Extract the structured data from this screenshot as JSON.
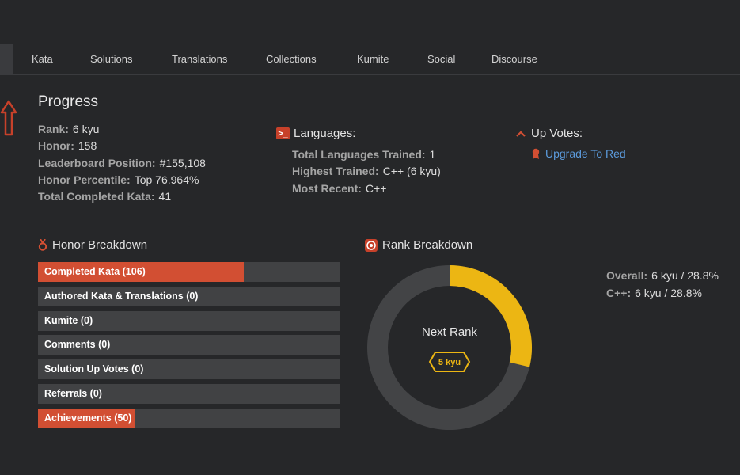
{
  "nav": {
    "items": [
      {
        "label": "Kata"
      },
      {
        "label": "Solutions"
      },
      {
        "label": "Translations"
      },
      {
        "label": "Collections"
      },
      {
        "label": "Kumite"
      },
      {
        "label": "Social"
      },
      {
        "label": "Discourse"
      }
    ]
  },
  "progress": {
    "title": "Progress",
    "stats": [
      {
        "label": "Rank:",
        "value": "6 kyu"
      },
      {
        "label": "Honor:",
        "value": "158"
      },
      {
        "label": "Leaderboard Position:",
        "value": "#155,108"
      },
      {
        "label": "Honor Percentile:",
        "value": "Top 76.964%"
      },
      {
        "label": "Total Completed Kata:",
        "value": "41"
      }
    ]
  },
  "languages": {
    "heading": "Languages:",
    "icon": "terminal-icon",
    "rows": [
      {
        "label": "Total Languages Trained:",
        "value": "1"
      },
      {
        "label": "Highest Trained:",
        "value": "C++ (6 kyu)"
      },
      {
        "label": "Most Recent:",
        "value": "C++"
      }
    ]
  },
  "upvotes": {
    "heading": "Up Votes:",
    "icon": "chevron-up-icon",
    "link_label": "Upgrade To Red",
    "link_icon": "ribbon-icon"
  },
  "honor_breakdown": {
    "heading": "Honor Breakdown",
    "icon": "medal-icon",
    "bars": [
      {
        "label": "Completed Kata (106)",
        "fill": 0.68
      },
      {
        "label": "Authored Kata & Translations (0)",
        "fill": 0
      },
      {
        "label": "Kumite (0)",
        "fill": 0
      },
      {
        "label": "Comments (0)",
        "fill": 0
      },
      {
        "label": "Solution Up Votes (0)",
        "fill": 0
      },
      {
        "label": "Referrals (0)",
        "fill": 0
      },
      {
        "label": "Achievements (50)",
        "fill": 0.32
      }
    ]
  },
  "rank_breakdown": {
    "heading": "Rank Breakdown",
    "icon": "target-icon",
    "donut_center_label": "Next Rank",
    "next_rank": "5 kyu",
    "progress": 0.288,
    "rows": [
      {
        "label": "Overall:",
        "value": "6 kyu / 28.8%"
      },
      {
        "label": "C++:",
        "value": "6 kyu / 28.8%"
      }
    ]
  },
  "colors": {
    "accent": "#d24f33",
    "rank_yellow": "#ecb613",
    "link": "#5b9adb",
    "background": "#262729"
  }
}
